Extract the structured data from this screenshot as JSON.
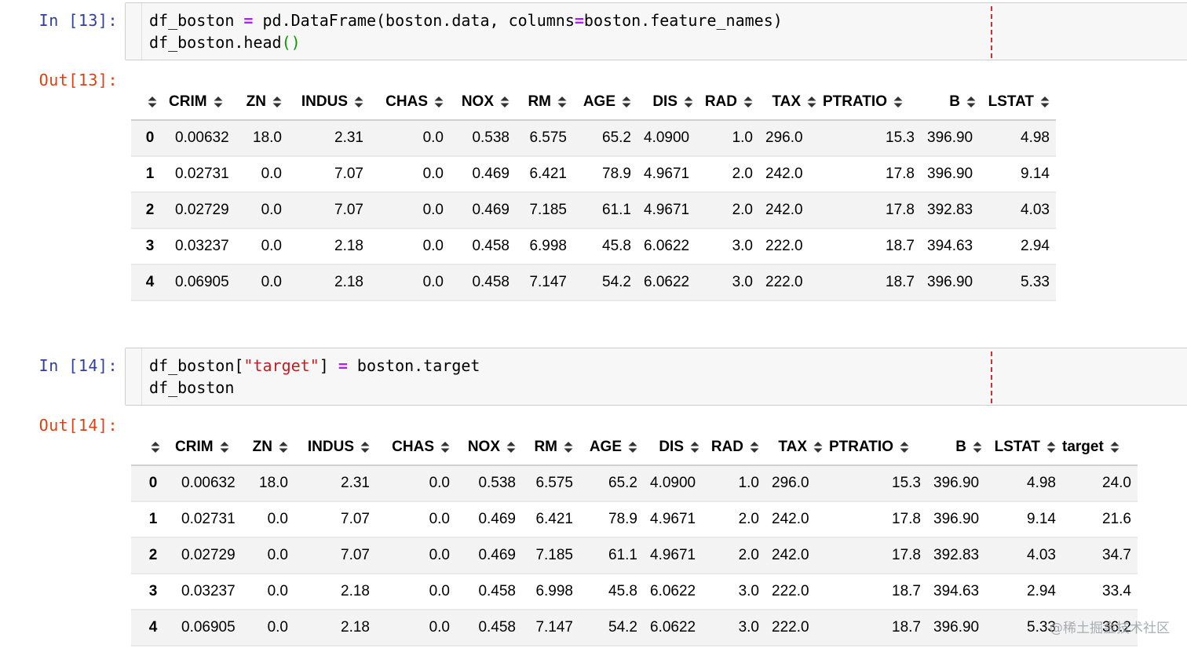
{
  "cells": [
    {
      "in_prompt": "In [13]:",
      "code_lines": [
        [
          {
            "t": "df_boston ",
            "c": ""
          },
          {
            "t": "=",
            "c": "op"
          },
          {
            "t": " pd.DataFrame(boston.data, columns",
            "c": ""
          },
          {
            "t": "=",
            "c": "op"
          },
          {
            "t": "boston.feature_names)",
            "c": ""
          }
        ],
        [
          {
            "t": "df_boston.head",
            "c": ""
          },
          {
            "t": "()",
            "c": "paren"
          }
        ]
      ],
      "out_prompt": "Out[13]:",
      "table": {
        "columns": [
          "CRIM",
          "ZN",
          "INDUS",
          "CHAS",
          "NOX",
          "RM",
          "AGE",
          "DIS",
          "RAD",
          "TAX",
          "PTRATIO",
          "B",
          "LSTAT"
        ],
        "rows": [
          {
            "index": "0",
            "values": [
              "0.00632",
              "18.0",
              "2.31",
              "0.0",
              "0.538",
              "6.575",
              "65.2",
              "4.0900",
              "1.0",
              "296.0",
              "15.3",
              "396.90",
              "4.98"
            ]
          },
          {
            "index": "1",
            "values": [
              "0.02731",
              "0.0",
              "7.07",
              "0.0",
              "0.469",
              "6.421",
              "78.9",
              "4.9671",
              "2.0",
              "242.0",
              "17.8",
              "396.90",
              "9.14"
            ]
          },
          {
            "index": "2",
            "values": [
              "0.02729",
              "0.0",
              "7.07",
              "0.0",
              "0.469",
              "7.185",
              "61.1",
              "4.9671",
              "2.0",
              "242.0",
              "17.8",
              "392.83",
              "4.03"
            ]
          },
          {
            "index": "3",
            "values": [
              "0.03237",
              "0.0",
              "2.18",
              "0.0",
              "0.458",
              "6.998",
              "45.8",
              "6.0622",
              "3.0",
              "222.0",
              "18.7",
              "394.63",
              "2.94"
            ]
          },
          {
            "index": "4",
            "values": [
              "0.06905",
              "0.0",
              "2.18",
              "0.0",
              "0.458",
              "7.147",
              "54.2",
              "6.0622",
              "3.0",
              "222.0",
              "18.7",
              "396.90",
              "5.33"
            ]
          }
        ]
      }
    },
    {
      "in_prompt": "In [14]:",
      "code_lines": [
        [
          {
            "t": "df_boston[",
            "c": ""
          },
          {
            "t": "\"target\"",
            "c": "str"
          },
          {
            "t": "] ",
            "c": ""
          },
          {
            "t": "=",
            "c": "op"
          },
          {
            "t": " boston.target",
            "c": ""
          }
        ],
        [
          {
            "t": "df_boston",
            "c": ""
          }
        ]
      ],
      "out_prompt": "Out[14]:",
      "table": {
        "columns": [
          "CRIM",
          "ZN",
          "INDUS",
          "CHAS",
          "NOX",
          "RM",
          "AGE",
          "DIS",
          "RAD",
          "TAX",
          "PTRATIO",
          "B",
          "LSTAT",
          "target"
        ],
        "rows": [
          {
            "index": "0",
            "values": [
              "0.00632",
              "18.0",
              "2.31",
              "0.0",
              "0.538",
              "6.575",
              "65.2",
              "4.0900",
              "1.0",
              "296.0",
              "15.3",
              "396.90",
              "4.98",
              "24.0"
            ]
          },
          {
            "index": "1",
            "values": [
              "0.02731",
              "0.0",
              "7.07",
              "0.0",
              "0.469",
              "6.421",
              "78.9",
              "4.9671",
              "2.0",
              "242.0",
              "17.8",
              "396.90",
              "9.14",
              "21.6"
            ]
          },
          {
            "index": "2",
            "values": [
              "0.02729",
              "0.0",
              "7.07",
              "0.0",
              "0.469",
              "7.185",
              "61.1",
              "4.9671",
              "2.0",
              "242.0",
              "17.8",
              "392.83",
              "4.03",
              "34.7"
            ]
          },
          {
            "index": "3",
            "values": [
              "0.03237",
              "0.0",
              "2.18",
              "0.0",
              "0.458",
              "6.998",
              "45.8",
              "6.0622",
              "3.0",
              "222.0",
              "18.7",
              "394.63",
              "2.94",
              "33.4"
            ]
          },
          {
            "index": "4",
            "values": [
              "0.06905",
              "0.0",
              "2.18",
              "0.0",
              "0.458",
              "7.147",
              "54.2",
              "6.0622",
              "3.0",
              "222.0",
              "18.7",
              "396.90",
              "5.33",
              "36.2"
            ]
          }
        ]
      }
    }
  ],
  "sort_icon": "sort-updown-icon",
  "colors": {
    "in_prompt": "#303f9f",
    "out_prompt": "#d84315",
    "operator": "#aa22ff",
    "string": "#ba2121",
    "paren": "#0a9a00",
    "ruler": "#d32f2f"
  },
  "watermark": "@稀土掘金技术社区"
}
